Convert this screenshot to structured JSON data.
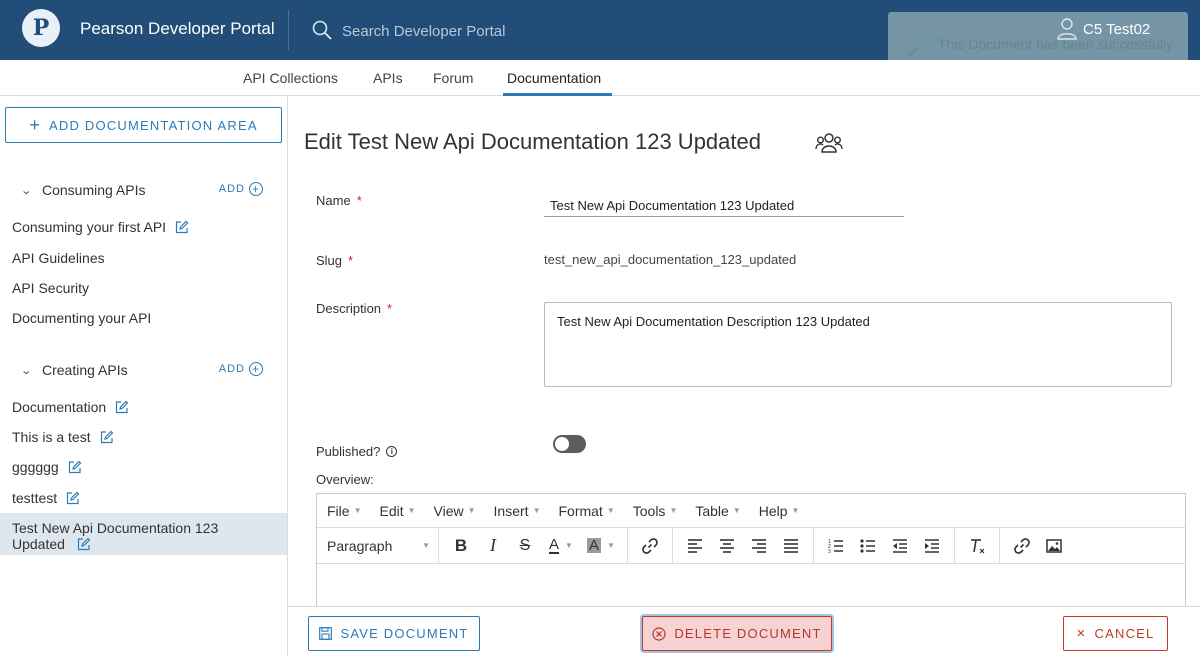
{
  "header": {
    "logo_letter": "P",
    "brand": "Pearson Developer Portal",
    "search_placeholder": "Search Developer Portal",
    "user_name": "C5 Test02",
    "toast_text": "This Document has been successfully saved"
  },
  "nav": {
    "items": [
      "API Collections",
      "APIs",
      "Forum",
      "Documentation"
    ],
    "active": "Documentation"
  },
  "sidebar": {
    "add_area_label": "ADD DOCUMENTATION AREA",
    "groups": [
      {
        "title": "Consuming APIs",
        "add_label": "ADD",
        "items": [
          "Consuming your first API",
          "API Guidelines",
          "API Security",
          "Documenting your API"
        ]
      },
      {
        "title": "Creating APIs",
        "add_label": "ADD",
        "items": [
          "Documentation",
          "This is a test",
          "gggggg",
          "testtest",
          "Test New Api Documentation 123 Updated"
        ]
      }
    ],
    "active_item": "Test New Api Documentation 123 Updated"
  },
  "form": {
    "title": "Edit Test New Api Documentation 123 Updated",
    "name_label": "Name",
    "name_value": "Test New Api Documentation 123 Updated",
    "slug_label": "Slug",
    "slug_value": "test_new_api_documentation_123_updated",
    "description_label": "Description",
    "description_value": "Test New Api Documentation Description 123 Updated",
    "published_label": "Published?",
    "published": false,
    "overview_label": "Overview:",
    "required_mark": "*"
  },
  "editor": {
    "menus": [
      "File",
      "Edit",
      "View",
      "Insert",
      "Format",
      "Tools",
      "Table",
      "Help"
    ],
    "block_format": "Paragraph"
  },
  "footer": {
    "save_label": "SAVE DOCUMENT",
    "delete_label": "DELETE DOCUMENT",
    "cancel_label": "CANCEL"
  },
  "colors": {
    "header_bg": "#214d78",
    "accent": "#2e7bb4",
    "danger": "#c0392b",
    "active_item_bg": "#dfe7ee"
  }
}
